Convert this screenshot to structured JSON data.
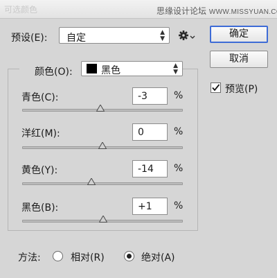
{
  "window": {
    "title": "可选颜色"
  },
  "watermark": {
    "site_name": "思缘设计论坛",
    "url": "WWW.MISSYUAN.COM"
  },
  "preset": {
    "label": "预设(E):",
    "value": "自定"
  },
  "buttons": {
    "ok": "确定",
    "cancel": "取消"
  },
  "preview": {
    "label": "预览(P)",
    "checked": true
  },
  "color_select": {
    "label": "颜色(O):",
    "value": "黑色",
    "swatch_color": "#000000"
  },
  "sliders": [
    {
      "label": "青色(C):",
      "value": "-3",
      "unit": "%",
      "fraction": 0.485
    },
    {
      "label": "洋红(M):",
      "value": "0",
      "unit": "%",
      "fraction": 0.5
    },
    {
      "label": "黄色(Y):",
      "value": "-14",
      "unit": "%",
      "fraction": 0.43
    },
    {
      "label": "黑色(B):",
      "value": "+1",
      "unit": "%",
      "fraction": 0.505
    }
  ],
  "method": {
    "label": "方法:",
    "options": [
      {
        "label": "相对(R)",
        "selected": false
      },
      {
        "label": "绝对(A)",
        "selected": true
      }
    ]
  },
  "colors": {
    "primary_button_border": "#3d6bd6"
  }
}
